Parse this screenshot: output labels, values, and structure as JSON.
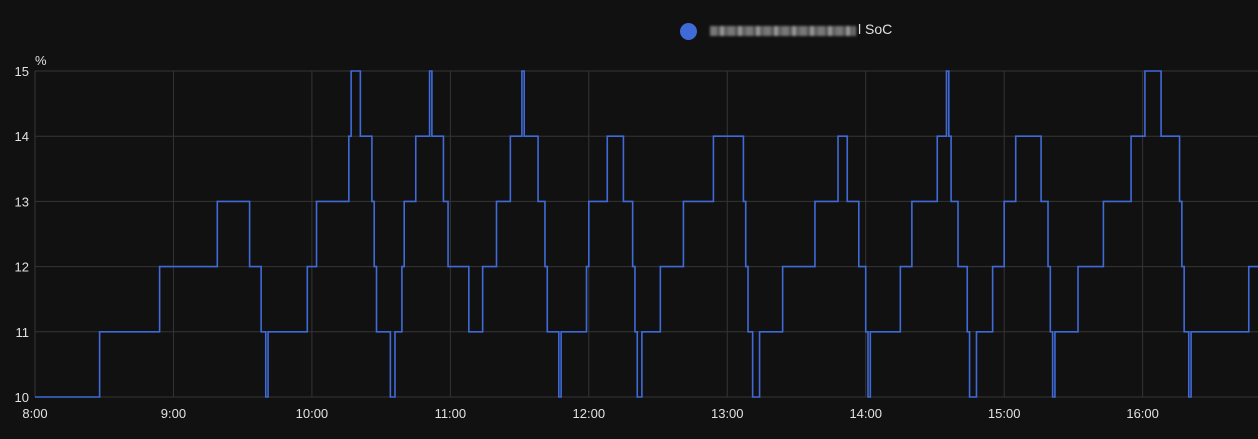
{
  "chart_data": {
    "type": "line",
    "step": true,
    "series": [
      {
        "name": "SoC",
        "legend_text_prefix_blurred": true,
        "color": "#3f6ad8",
        "x": [
          "8:00",
          "8:28",
          "8:54",
          "9:19",
          "9:33",
          "9:38",
          "9:40",
          "9:41",
          "9:42",
          "9:58",
          "10:02",
          "10:16",
          "10:17",
          "10:21",
          "10:26",
          "10:27",
          "10:28",
          "10:34",
          "10:36",
          "10:39",
          "10:40",
          "10:45",
          "10:51",
          "10:52",
          "10:57",
          "10:59",
          "11:08",
          "11:14",
          "11:20",
          "11:26",
          "11:31",
          "11:32",
          "11:38",
          "11:41",
          "11:42",
          "11:47",
          "11:48",
          "11:49",
          "11:59",
          "12:00",
          "12:08",
          "12:15",
          "12:19",
          "12:20",
          "12:21",
          "12:23",
          "12:31",
          "12:41",
          "12:54",
          "13:07",
          "13:08",
          "13:09",
          "13:11",
          "13:14",
          "13:24",
          "13:38",
          "13:48",
          "13:52",
          "13:57",
          "14:00",
          "14:01",
          "14:02",
          "14:15",
          "14:20",
          "14:31",
          "14:35",
          "14:36",
          "14:37",
          "14:40",
          "14:44",
          "14:45",
          "14:48",
          "14:55",
          "15:00",
          "15:05",
          "15:16",
          "15:19",
          "15:20",
          "15:21",
          "15:22",
          "15:32",
          "15:43",
          "15:55",
          "16:01",
          "16:08",
          "16:16",
          "16:17",
          "16:18",
          "16:20",
          "16:21",
          "16:23",
          "16:24",
          "16:46",
          "16:50"
        ],
        "y": [
          10,
          11,
          12,
          13,
          12,
          11,
          10,
          11,
          11,
          12,
          13,
          14,
          15,
          14,
          13,
          12,
          11,
          10,
          11,
          12,
          13,
          14,
          15,
          14,
          13,
          12,
          11,
          12,
          13,
          14,
          15,
          14,
          13,
          12,
          11,
          10,
          11,
          11,
          12,
          13,
          14,
          13,
          12,
          11,
          10,
          11,
          12,
          13,
          14,
          13,
          12,
          11,
          10,
          11,
          12,
          13,
          14,
          13,
          12,
          11,
          10,
          11,
          12,
          13,
          14,
          15,
          14,
          13,
          12,
          11,
          10,
          11,
          12,
          13,
          14,
          13,
          12,
          11,
          10,
          11,
          12,
          13,
          14,
          15,
          14,
          13,
          12,
          11,
          10,
          11,
          11,
          11,
          12,
          12
        ]
      }
    ],
    "ylabel": "%",
    "ylim": [
      10,
      15
    ],
    "xlim": [
      "8:00",
      "16:50"
    ],
    "yticks": [
      "10",
      "11",
      "12",
      "13",
      "14",
      "15"
    ],
    "xticks": [
      "8:00",
      "9:00",
      "10:00",
      "11:00",
      "12:00",
      "13:00",
      "14:00",
      "15:00",
      "16:00"
    ],
    "grid": true,
    "legend": "top-center"
  },
  "legend": {
    "label_suffix": "l SoC",
    "color": "#3f6ad8"
  }
}
